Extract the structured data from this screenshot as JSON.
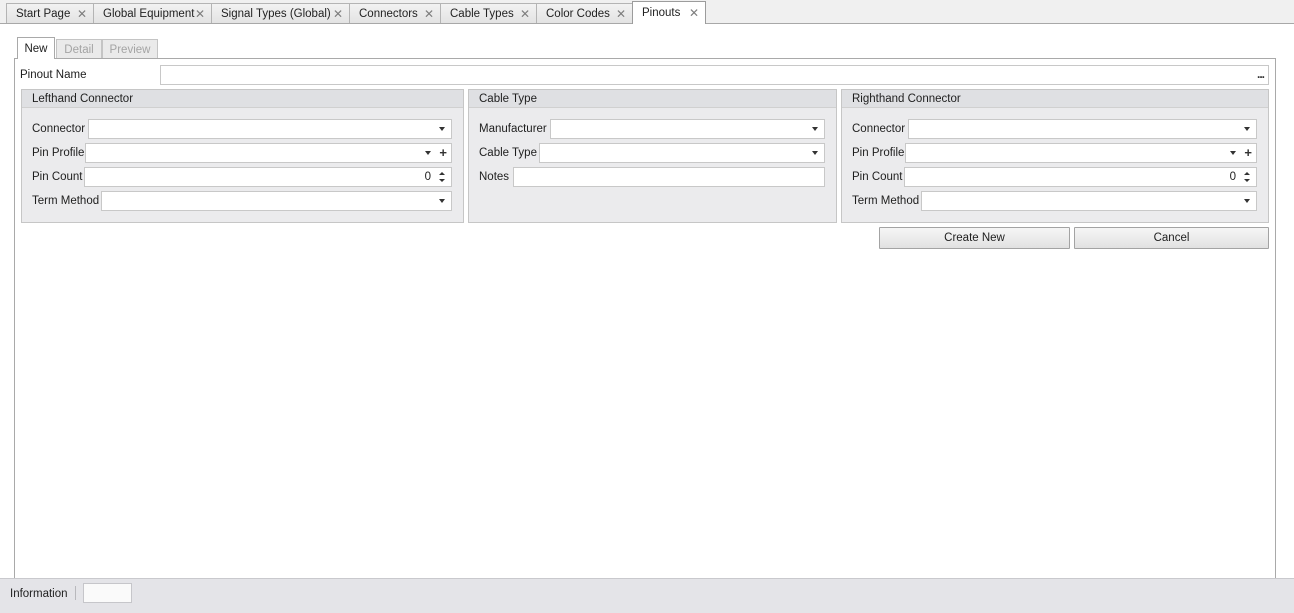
{
  "document_tabs": [
    {
      "label": "Start Page",
      "active": false
    },
    {
      "label": "Global Equipment",
      "active": false
    },
    {
      "label": "Signal Types (Global)",
      "active": false
    },
    {
      "label": "Connectors",
      "active": false
    },
    {
      "label": "Cable Types",
      "active": false
    },
    {
      "label": "Color Codes",
      "active": false
    },
    {
      "label": "Pinouts",
      "active": true
    }
  ],
  "sub_tabs": [
    {
      "label": "New",
      "active": true,
      "enabled": true
    },
    {
      "label": "Detail",
      "active": false,
      "enabled": false
    },
    {
      "label": "Preview",
      "active": false,
      "enabled": false
    }
  ],
  "pinout_name": {
    "label": "Pinout Name",
    "value": "",
    "button_text": "..."
  },
  "lefthand_connector": {
    "title": "Lefthand Connector",
    "connector_label": "Connector",
    "connector_value": "",
    "pin_profile_label": "Pin Profile",
    "pin_profile_value": "",
    "pin_count_label": "Pin Count",
    "pin_count_value": "0",
    "term_method_label": "Term Method",
    "term_method_value": ""
  },
  "cable_type": {
    "title": "Cable Type",
    "manufacturer_label": "Manufacturer",
    "manufacturer_value": "",
    "cable_type_label": "Cable Type",
    "cable_type_value": "",
    "notes_label": "Notes",
    "notes_value": ""
  },
  "righthand_connector": {
    "title": "Righthand Connector",
    "connector_label": "Connector",
    "connector_value": "",
    "pin_profile_label": "Pin Profile",
    "pin_profile_value": "",
    "pin_count_label": "Pin Count",
    "pin_count_value": "0",
    "term_method_label": "Term Method",
    "term_method_value": ""
  },
  "buttons": {
    "create_new": "Create New",
    "cancel": "Cancel"
  },
  "statusbar": {
    "label": "Information",
    "value": ""
  },
  "icons": {
    "close": "close-icon",
    "dropdown": "chevron-down-icon",
    "add": "plus-icon",
    "ellipsis": "ellipsis-icon",
    "spin": "spin-up-down-icon"
  },
  "colors": {
    "window_background": "#f0f0f0",
    "panel_background": "#ffffff",
    "group_background": "#ebebed",
    "group_header": "#dfe0e3",
    "border": "#a9a9a9",
    "disabled_text": "#a4a4a4"
  }
}
